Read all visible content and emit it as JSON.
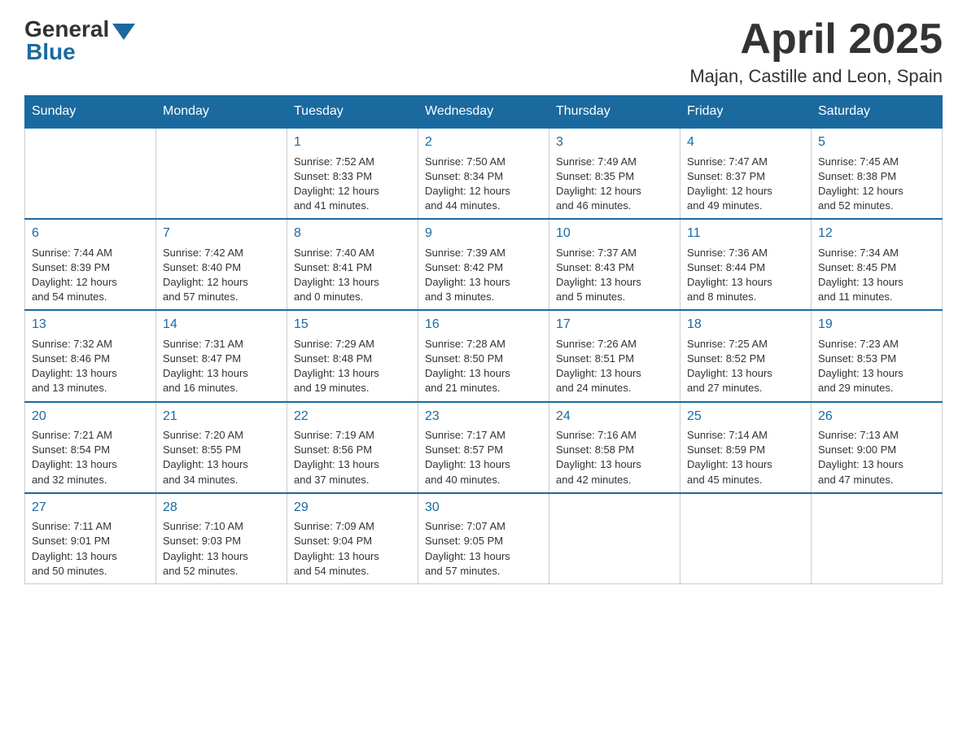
{
  "header": {
    "logo_general": "General",
    "logo_blue": "Blue",
    "month_title": "April 2025",
    "location": "Majan, Castille and Leon, Spain"
  },
  "weekdays": [
    "Sunday",
    "Monday",
    "Tuesday",
    "Wednesday",
    "Thursday",
    "Friday",
    "Saturday"
  ],
  "weeks": [
    [
      {
        "day": "",
        "info": ""
      },
      {
        "day": "",
        "info": ""
      },
      {
        "day": "1",
        "info": "Sunrise: 7:52 AM\nSunset: 8:33 PM\nDaylight: 12 hours\nand 41 minutes."
      },
      {
        "day": "2",
        "info": "Sunrise: 7:50 AM\nSunset: 8:34 PM\nDaylight: 12 hours\nand 44 minutes."
      },
      {
        "day": "3",
        "info": "Sunrise: 7:49 AM\nSunset: 8:35 PM\nDaylight: 12 hours\nand 46 minutes."
      },
      {
        "day": "4",
        "info": "Sunrise: 7:47 AM\nSunset: 8:37 PM\nDaylight: 12 hours\nand 49 minutes."
      },
      {
        "day": "5",
        "info": "Sunrise: 7:45 AM\nSunset: 8:38 PM\nDaylight: 12 hours\nand 52 minutes."
      }
    ],
    [
      {
        "day": "6",
        "info": "Sunrise: 7:44 AM\nSunset: 8:39 PM\nDaylight: 12 hours\nand 54 minutes."
      },
      {
        "day": "7",
        "info": "Sunrise: 7:42 AM\nSunset: 8:40 PM\nDaylight: 12 hours\nand 57 minutes."
      },
      {
        "day": "8",
        "info": "Sunrise: 7:40 AM\nSunset: 8:41 PM\nDaylight: 13 hours\nand 0 minutes."
      },
      {
        "day": "9",
        "info": "Sunrise: 7:39 AM\nSunset: 8:42 PM\nDaylight: 13 hours\nand 3 minutes."
      },
      {
        "day": "10",
        "info": "Sunrise: 7:37 AM\nSunset: 8:43 PM\nDaylight: 13 hours\nand 5 minutes."
      },
      {
        "day": "11",
        "info": "Sunrise: 7:36 AM\nSunset: 8:44 PM\nDaylight: 13 hours\nand 8 minutes."
      },
      {
        "day": "12",
        "info": "Sunrise: 7:34 AM\nSunset: 8:45 PM\nDaylight: 13 hours\nand 11 minutes."
      }
    ],
    [
      {
        "day": "13",
        "info": "Sunrise: 7:32 AM\nSunset: 8:46 PM\nDaylight: 13 hours\nand 13 minutes."
      },
      {
        "day": "14",
        "info": "Sunrise: 7:31 AM\nSunset: 8:47 PM\nDaylight: 13 hours\nand 16 minutes."
      },
      {
        "day": "15",
        "info": "Sunrise: 7:29 AM\nSunset: 8:48 PM\nDaylight: 13 hours\nand 19 minutes."
      },
      {
        "day": "16",
        "info": "Sunrise: 7:28 AM\nSunset: 8:50 PM\nDaylight: 13 hours\nand 21 minutes."
      },
      {
        "day": "17",
        "info": "Sunrise: 7:26 AM\nSunset: 8:51 PM\nDaylight: 13 hours\nand 24 minutes."
      },
      {
        "day": "18",
        "info": "Sunrise: 7:25 AM\nSunset: 8:52 PM\nDaylight: 13 hours\nand 27 minutes."
      },
      {
        "day": "19",
        "info": "Sunrise: 7:23 AM\nSunset: 8:53 PM\nDaylight: 13 hours\nand 29 minutes."
      }
    ],
    [
      {
        "day": "20",
        "info": "Sunrise: 7:21 AM\nSunset: 8:54 PM\nDaylight: 13 hours\nand 32 minutes."
      },
      {
        "day": "21",
        "info": "Sunrise: 7:20 AM\nSunset: 8:55 PM\nDaylight: 13 hours\nand 34 minutes."
      },
      {
        "day": "22",
        "info": "Sunrise: 7:19 AM\nSunset: 8:56 PM\nDaylight: 13 hours\nand 37 minutes."
      },
      {
        "day": "23",
        "info": "Sunrise: 7:17 AM\nSunset: 8:57 PM\nDaylight: 13 hours\nand 40 minutes."
      },
      {
        "day": "24",
        "info": "Sunrise: 7:16 AM\nSunset: 8:58 PM\nDaylight: 13 hours\nand 42 minutes."
      },
      {
        "day": "25",
        "info": "Sunrise: 7:14 AM\nSunset: 8:59 PM\nDaylight: 13 hours\nand 45 minutes."
      },
      {
        "day": "26",
        "info": "Sunrise: 7:13 AM\nSunset: 9:00 PM\nDaylight: 13 hours\nand 47 minutes."
      }
    ],
    [
      {
        "day": "27",
        "info": "Sunrise: 7:11 AM\nSunset: 9:01 PM\nDaylight: 13 hours\nand 50 minutes."
      },
      {
        "day": "28",
        "info": "Sunrise: 7:10 AM\nSunset: 9:03 PM\nDaylight: 13 hours\nand 52 minutes."
      },
      {
        "day": "29",
        "info": "Sunrise: 7:09 AM\nSunset: 9:04 PM\nDaylight: 13 hours\nand 54 minutes."
      },
      {
        "day": "30",
        "info": "Sunrise: 7:07 AM\nSunset: 9:05 PM\nDaylight: 13 hours\nand 57 minutes."
      },
      {
        "day": "",
        "info": ""
      },
      {
        "day": "",
        "info": ""
      },
      {
        "day": "",
        "info": ""
      }
    ]
  ]
}
